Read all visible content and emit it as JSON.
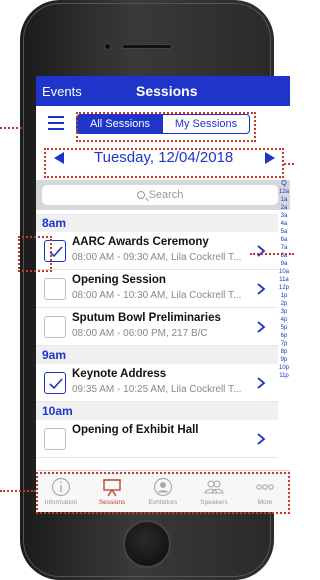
{
  "nav": {
    "back_label": "Events",
    "title": "Sessions"
  },
  "toolbar": {
    "segments": [
      "All Sessions",
      "My Sessions"
    ],
    "selected_segment": "All Sessions"
  },
  "date": {
    "label": "Tuesday, 12/04/2018"
  },
  "search": {
    "placeholder": "Search"
  },
  "index_labels": [
    "Q",
    "12a",
    "1a",
    "2a",
    "3a",
    "4a",
    "5a",
    "6a",
    "7a",
    "8a",
    "9a",
    "10a",
    "11a",
    "12p",
    "1p",
    "2p",
    "3p",
    "4p",
    "5p",
    "6p",
    "7p",
    "8p",
    "9p",
    "10p",
    "11p"
  ],
  "sections": [
    {
      "title": "8am",
      "rows": [
        {
          "title": "AARC Awards Ceremony",
          "subtitle": "08:00 AM - 09:30 AM, Lila Cockrell T...",
          "checked": true
        },
        {
          "title": "Opening Session",
          "subtitle": "08:00 AM - 10:30 AM, Lila Cockrell T...",
          "checked": false
        },
        {
          "title": "Sputum Bowl Preliminaries",
          "subtitle": "08:00 AM - 06:00 PM, 217 B/C",
          "checked": false
        }
      ]
    },
    {
      "title": "9am",
      "rows": [
        {
          "title": "Keynote Address",
          "subtitle": "09:35 AM - 10:25 AM, Lila Cockrell T...",
          "checked": true
        }
      ]
    },
    {
      "title": "10am",
      "rows": [
        {
          "title": "Opening of Exhibit Hall",
          "subtitle": "",
          "checked": false
        }
      ]
    }
  ],
  "tabs": [
    {
      "label": "Information",
      "icon": "info-icon"
    },
    {
      "label": "Sessions",
      "icon": "presentation-icon",
      "active": true
    },
    {
      "label": "Exhibitors",
      "icon": "exhibitor-icon"
    },
    {
      "label": "Speakers",
      "icon": "speakers-icon"
    },
    {
      "label": "More",
      "icon": "more-icon"
    }
  ],
  "colors": {
    "accent": "#1f34c9",
    "highlight": "#c0392b"
  }
}
